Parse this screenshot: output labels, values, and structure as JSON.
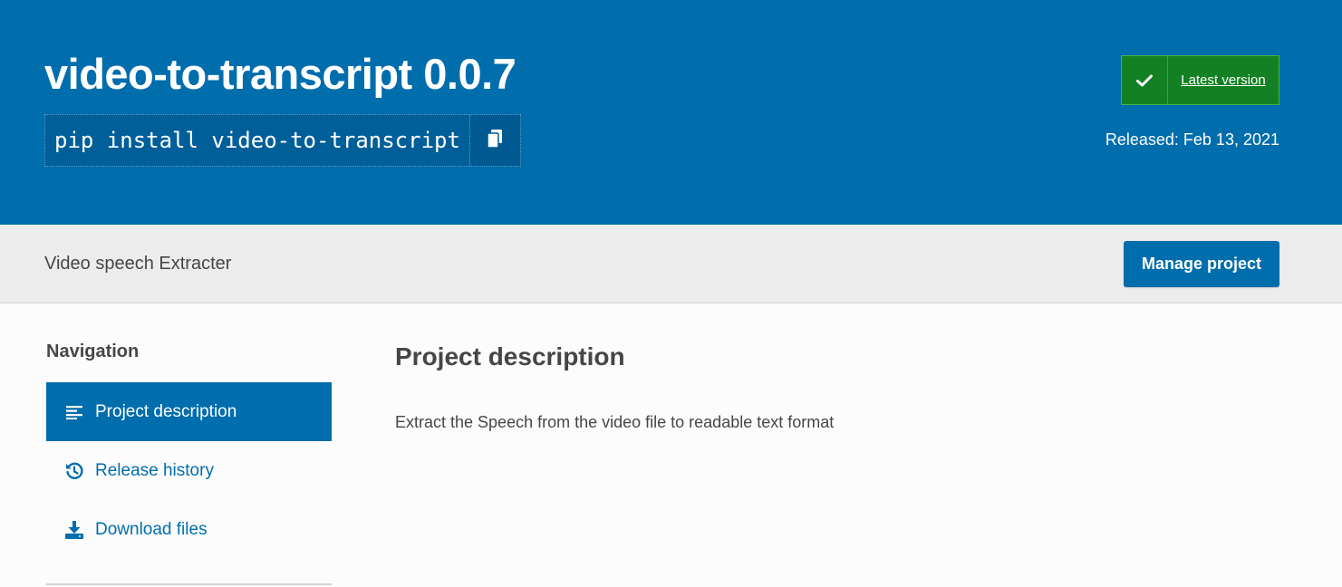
{
  "header": {
    "package_title": "video-to-transcript 0.0.7",
    "pip_command": "pip install video-to-transcript",
    "copy_icon": "copy-icon",
    "version_badge": {
      "icon": "checkmark-icon",
      "label": "Latest version"
    },
    "release_date": "Released: Feb 13, 2021"
  },
  "summary": {
    "text": "Video speech Extracter",
    "manage_button": "Manage project"
  },
  "sidebar": {
    "heading": "Navigation",
    "items": [
      {
        "label": "Project description",
        "icon": "align-left-icon",
        "active": true
      },
      {
        "label": "Release history",
        "icon": "history-icon",
        "active": false
      },
      {
        "label": "Download files",
        "icon": "download-icon",
        "active": false
      }
    ]
  },
  "main": {
    "heading": "Project description",
    "body": "Extract the Speech from the video file to readable text format"
  },
  "colors": {
    "brand_blue": "#006dad",
    "badge_green": "#148024",
    "summary_bg": "#ececec",
    "text": "#464646"
  }
}
